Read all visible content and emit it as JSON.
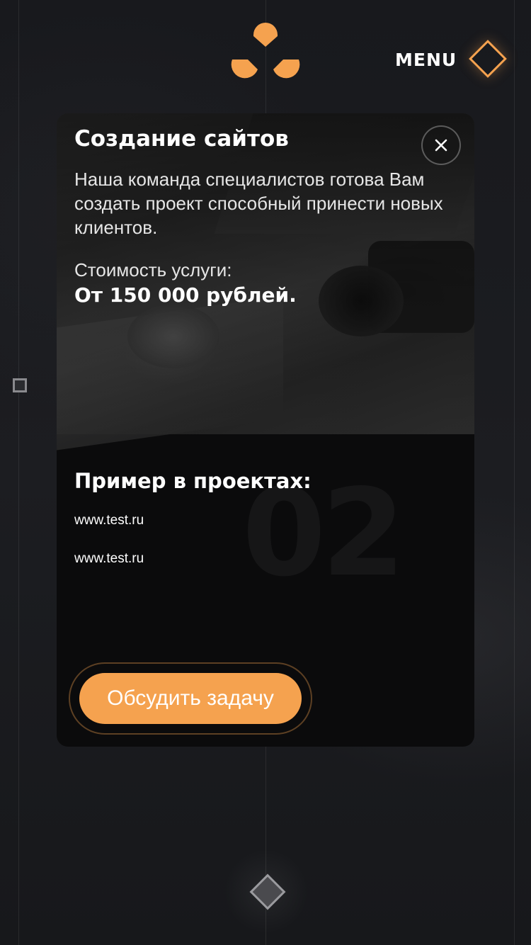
{
  "header": {
    "menu_label": "MENU",
    "icons": {
      "logo": "three-dots-logo",
      "menu": "diamond-icon"
    }
  },
  "card": {
    "title": "Создание сайтов",
    "description": "Наша команда специалистов готова Вам создать проект способный принести новых клиентов.",
    "price_label": "Стоимость услуги:",
    "price_value": "От 150 000 рублей.",
    "examples_title": "Пример в проектах:",
    "examples": [
      "www.test.ru",
      "www.test.ru"
    ],
    "number": "02",
    "cta_label": "Обсудить задачу",
    "close_icon": "close-icon"
  },
  "colors": {
    "accent": "#f5a24f",
    "background": "#16171b",
    "card": "#0b0b0c"
  }
}
